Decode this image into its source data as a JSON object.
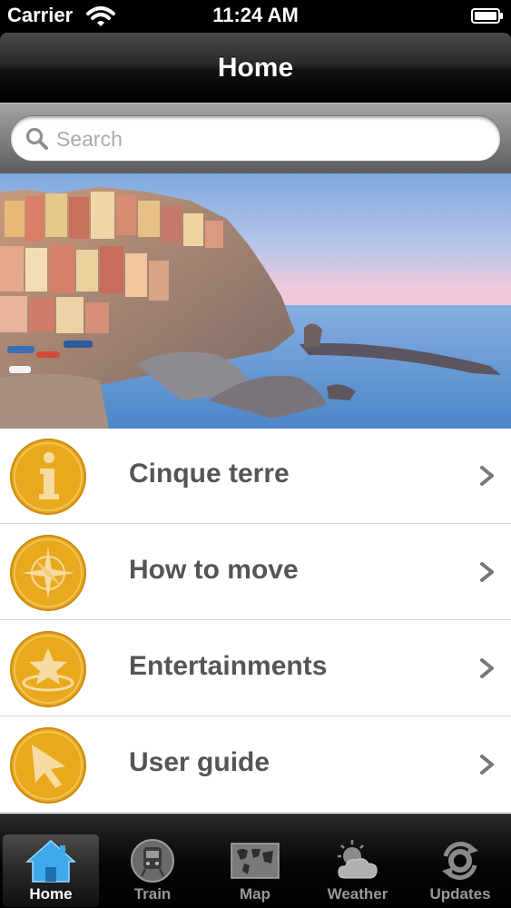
{
  "status_bar": {
    "carrier": "Carrier",
    "time": "11:24 AM"
  },
  "nav_bar": {
    "title": "Home"
  },
  "search": {
    "placeholder": "Search",
    "value": ""
  },
  "menu": {
    "items": [
      {
        "label": "Cinque terre",
        "icon": "info-icon"
      },
      {
        "label": "How to move",
        "icon": "compass-icon"
      },
      {
        "label": "Entertainments",
        "icon": "star-icon"
      },
      {
        "label": "User guide",
        "icon": "cursor-icon"
      }
    ]
  },
  "tab_bar": {
    "selected": "Home",
    "tabs": [
      {
        "label": "Home",
        "icon": "home-icon"
      },
      {
        "label": "Train",
        "icon": "train-icon"
      },
      {
        "label": "Map",
        "icon": "world-map-icon"
      },
      {
        "label": "Weather",
        "icon": "weather-icon"
      },
      {
        "label": "Updates",
        "icon": "refresh-icon"
      }
    ]
  },
  "colors": {
    "accent": "#E9A91E",
    "label": "#555555",
    "nav_bg": "#111111",
    "selected_tab_icon": "#3FA9F0"
  }
}
